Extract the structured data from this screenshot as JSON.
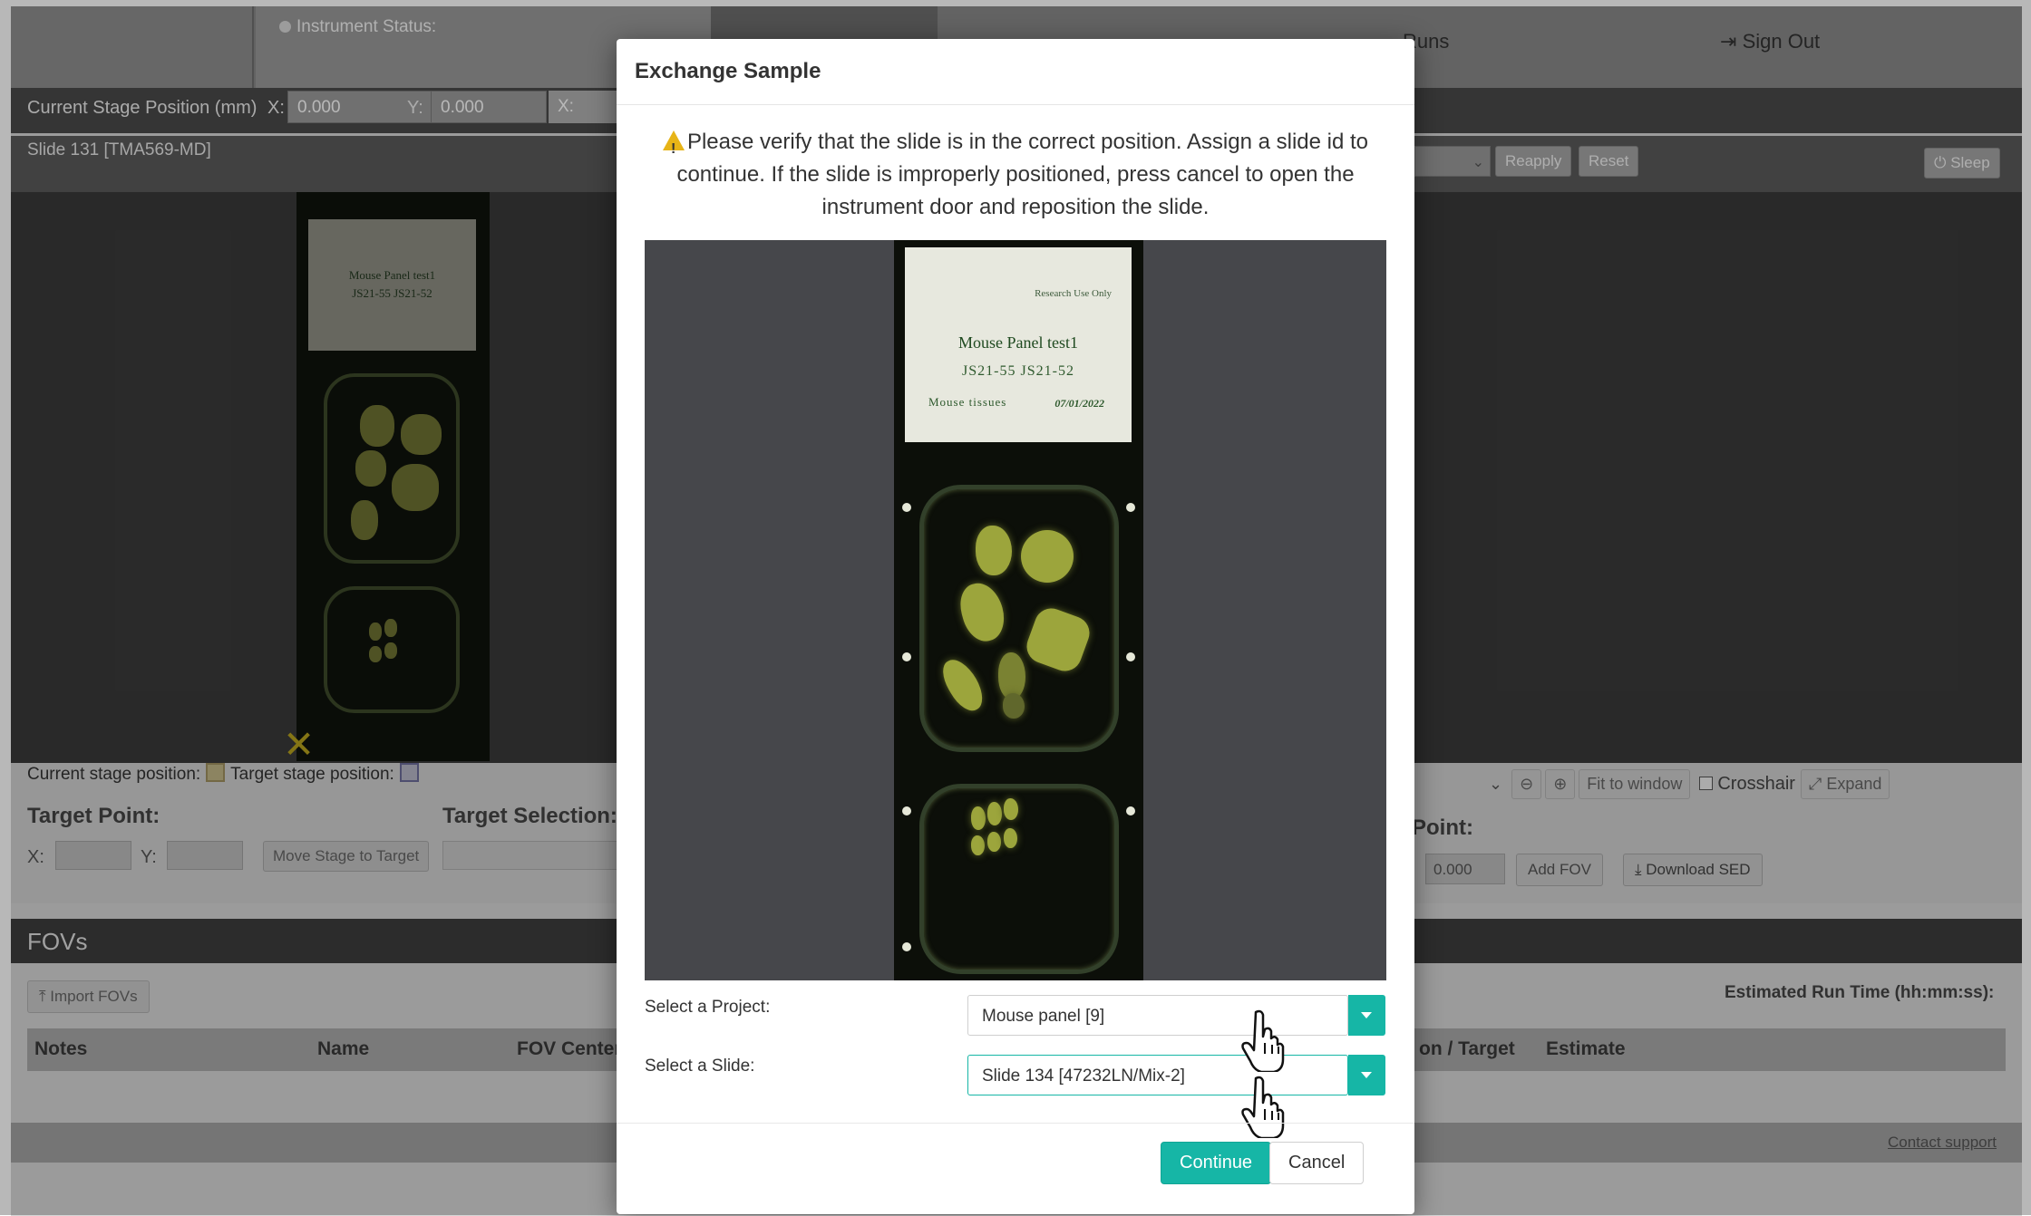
{
  "header": {
    "instrument_status_label": "Instrument Status:",
    "nav_runs": "Runs",
    "nav_signout": "Sign Out"
  },
  "stage": {
    "label": "Current Stage Position (mm)",
    "x_label": "X:",
    "x_value": "0.000",
    "y_label": "Y:",
    "y_value": "0.000",
    "z_label": "X:"
  },
  "viewer": {
    "slide_title": "Slide 131 [TMA569-MD]",
    "reapply": "Reapply",
    "reset": "Reset",
    "sleep": "Sleep",
    "thumb_label_1": "Mouse Panel test1",
    "thumb_label_2": "JS21-55 JS21-52"
  },
  "controls": {
    "current_stage_position": "Current stage position:",
    "target_stage_position": "Target stage position:",
    "target_point": "Target Point:",
    "target_selection": "Target Selection:",
    "x_label": "X:",
    "y_label": "Y:",
    "move_stage": "Move Stage to Target",
    "fit_to_window": "Fit to window",
    "crosshair": "Crosshair",
    "expand": "Expand",
    "point_heading": "Point:",
    "fov_x_value": "0.000",
    "add_fov": "Add FOV",
    "download_sed": "Download SED"
  },
  "fovs": {
    "title": "FOVs",
    "import": "Import FOVs",
    "estimated_run_time": "Estimated Run Time (hh:mm:ss):",
    "columns": [
      "Notes",
      "Name",
      "FOV Center",
      "on / Target",
      "Estimate"
    ]
  },
  "footer": {
    "contact_support": "Contact support"
  },
  "modal": {
    "title": "Exchange Sample",
    "message": "Please verify that the slide is in the correct position. Assign a slide id to continue. If the slide is improperly positioned, press cancel to open the instrument door and reposition the slide.",
    "slide_image": {
      "research_use_only": "Research Use Only",
      "line1": "Mouse Panel test1",
      "line2": "JS21-55 JS21-52",
      "line3": "Mouse tissues",
      "line4": "07/01/2022"
    },
    "project_label": "Select a Project:",
    "project_value": "Mouse panel [9]",
    "slide_label": "Select a Slide:",
    "slide_value": "Slide 134 [47232LN/Mix-2]",
    "continue": "Continue",
    "cancel": "Cancel"
  },
  "colors": {
    "accent": "#16b6a6",
    "warning": "#e7b417"
  }
}
